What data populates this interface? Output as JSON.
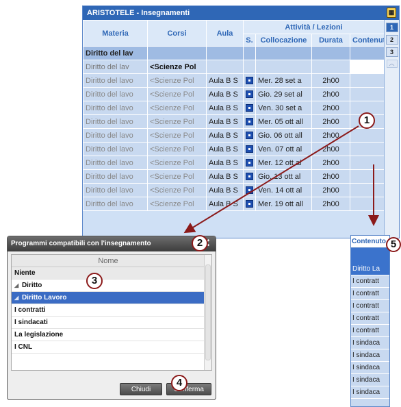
{
  "main_window": {
    "title": "ARISTOTELE - Insegnamenti",
    "headers": {
      "materia": "Materia",
      "corsi": "Corsi",
      "aula": "Aula",
      "attivita": "Attività / Lezioni",
      "s": "S.",
      "collocazione": "Collocazione",
      "durata": "Durata",
      "contenuto": "Contenuto"
    },
    "group_label": "Diritto del lav",
    "first_row": {
      "materia": "Diritto del lav",
      "corsi": "<Scienze Pol"
    },
    "rows": [
      {
        "materia": "Diritto del lavo",
        "corsi": "<Scienze Pol",
        "aula": "Aula B S",
        "collocazione": "Mer. 28 set a",
        "durata": "2h00"
      },
      {
        "materia": "Diritto del lavo",
        "corsi": "<Scienze Pol",
        "aula": "Aula B S",
        "collocazione": "Gio. 29 set al",
        "durata": "2h00"
      },
      {
        "materia": "Diritto del lavo",
        "corsi": "<Scienze Pol",
        "aula": "Aula B S",
        "collocazione": "Ven. 30 set a",
        "durata": "2h00"
      },
      {
        "materia": "Diritto del lavo",
        "corsi": "<Scienze Pol",
        "aula": "Aula B S",
        "collocazione": "Mer. 05 ott all",
        "durata": "2h00"
      },
      {
        "materia": "Diritto del lavo",
        "corsi": "<Scienze Pol",
        "aula": "Aula B S",
        "collocazione": "Gio. 06 ott all",
        "durata": "2h00"
      },
      {
        "materia": "Diritto del lavo",
        "corsi": "<Scienze Pol",
        "aula": "Aula B S",
        "collocazione": "Ven. 07 ott al",
        "durata": "2h00"
      },
      {
        "materia": "Diritto del lavo",
        "corsi": "<Scienze Pol",
        "aula": "Aula B S",
        "collocazione": "Mer. 12 ott al",
        "durata": "2h00"
      },
      {
        "materia": "Diritto del lavo",
        "corsi": "<Scienze Pol",
        "aula": "Aula B S",
        "collocazione": "Gio. 13 ott al",
        "durata": "2h00"
      },
      {
        "materia": "Diritto del lavo",
        "corsi": "<Scienze Pol",
        "aula": "Aula B S",
        "collocazione": "Ven. 14 ott al",
        "durata": "2h00"
      },
      {
        "materia": "Diritto del lavo",
        "corsi": "<Scienze Pol",
        "aula": "Aula B S",
        "collocazione": "Mer. 19 ott all",
        "durata": "2h00"
      }
    ],
    "side_tabs": [
      "1",
      "2",
      "3"
    ],
    "icon": "calendar-icon"
  },
  "dialog": {
    "title": "Programmi compatibili con l'insegnamento",
    "column_header": "Nome",
    "items": [
      {
        "label": "Niente",
        "indent": 0,
        "tri": ""
      },
      {
        "label": "Diritto",
        "indent": 0,
        "tri": "◢"
      },
      {
        "label": "Diritto Lavoro",
        "indent": 0,
        "tri": "◢"
      },
      {
        "label": "I contratti",
        "indent": 0,
        "tri": ""
      },
      {
        "label": "I sindacati",
        "indent": 0,
        "tri": ""
      },
      {
        "label": "La legislazione",
        "indent": 0,
        "tri": ""
      },
      {
        "label": "I CNL",
        "indent": 0,
        "tri": ""
      }
    ],
    "selected_index": 2,
    "buttons": {
      "cancel": "Chiudi",
      "confirm": "Conferma"
    }
  },
  "column_panel": {
    "header": "Contenuto",
    "cells": [
      "Diritto La",
      "I contratt",
      "I contratt",
      "I contratt",
      "I contratt",
      "I contratt",
      "I sindaca",
      "I sindaca",
      "I sindaca",
      "I sindaca",
      "I sindaca"
    ]
  },
  "callouts": [
    "1",
    "2",
    "3",
    "4",
    "5"
  ],
  "colors": {
    "accent": "#2f67b6",
    "callout_border": "#8b1a1a",
    "arrow": "#8b1a1a"
  }
}
